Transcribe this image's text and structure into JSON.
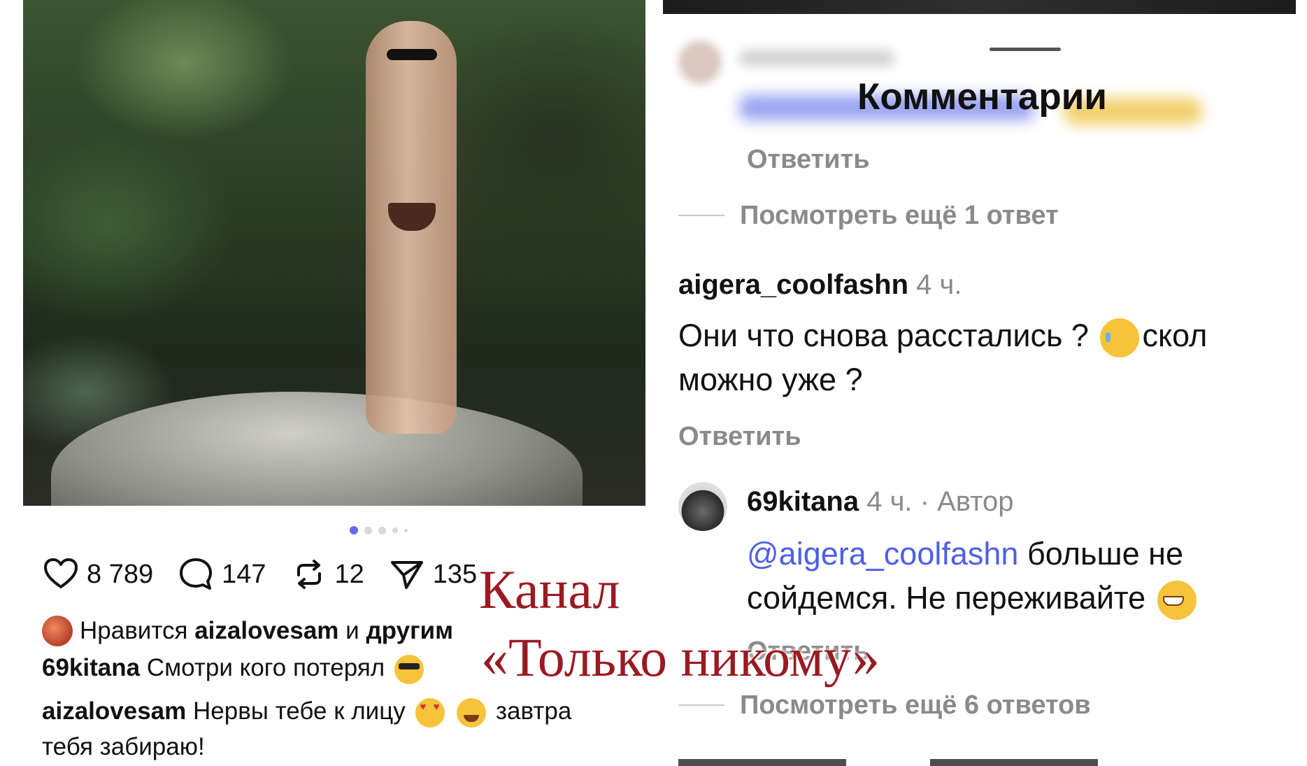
{
  "post": {
    "carousel": {
      "total": 5,
      "active": 1
    },
    "actions": {
      "likes": {
        "icon": "heart-icon",
        "count": "8 789"
      },
      "comments": {
        "icon": "comment-bubble-icon",
        "count": "147"
      },
      "reposts": {
        "icon": "repost-icon",
        "count": "12"
      },
      "shares": {
        "icon": "send-icon",
        "count": "135"
      }
    },
    "likes_line": {
      "prefix": "Нравится",
      "user": "aizalovesam",
      "middle": "и",
      "suffix": "другим"
    },
    "caption": {
      "user": "69kitana",
      "text": "Смотри кого потерял",
      "emoji": "smiling-face-with-sunglasses"
    },
    "top_comment": {
      "user": "aizalovesam",
      "text_before": "Нервы тебе к лицу",
      "emojis": [
        "smiling-face-with-heart-eyes",
        "face-with-tears-of-joy"
      ],
      "text_after": "завтра",
      "line2": "тебя забираю!"
    }
  },
  "comments_sheet": {
    "title": "Комментарии",
    "reply_label": "Ответить",
    "view_more_1": "Посмотреть ещё 1 ответ",
    "comment_1": {
      "user": "aigera_coolfashn",
      "time": "4 ч.",
      "line1": "Они что снова расстались ?",
      "emoji": "crying-face",
      "line1_cut": "скол",
      "line2": "можно уже ?"
    },
    "comment_2": {
      "user": "69kitana",
      "time": "4 ч.",
      "separator": "·",
      "role": "Автор",
      "mention": "@aigera_coolfashn",
      "line1": "больше не",
      "line2": "сойдемся. Не переживайте",
      "emoji": "grinning-face"
    },
    "view_more_2": "Посмотреть ещё 6 ответов"
  },
  "watermark": {
    "line1": "Канал",
    "line2": "«Только никому»"
  },
  "colors": {
    "mention": "#4d5fe8",
    "carousel_active": "#5f6ef0",
    "muted_text": "#8a8a8a",
    "watermark": "#9a1a22"
  }
}
